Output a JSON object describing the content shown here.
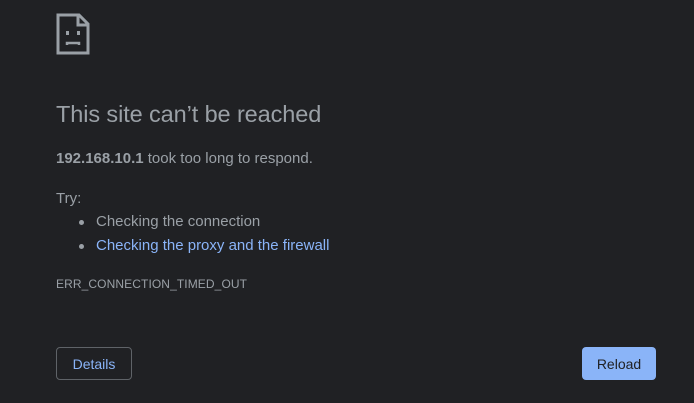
{
  "error_page": {
    "title": "This site can’t be reached",
    "host": "192.168.10.1",
    "summary_suffix": " took too long to respond.",
    "try_label": "Try:",
    "suggestions": [
      "Checking the connection",
      "Checking the proxy and the firewall"
    ],
    "error_code": "ERR_CONNECTION_TIMED_OUT",
    "details_label": "Details",
    "reload_label": "Reload"
  },
  "icons": {
    "error_icon": "sad-file-icon"
  },
  "colors": {
    "background": "#202124",
    "text": "#9aa0a6",
    "link": "#8ab4f8",
    "button_border": "#5f6368",
    "primary_button": "#8ab4f8"
  }
}
